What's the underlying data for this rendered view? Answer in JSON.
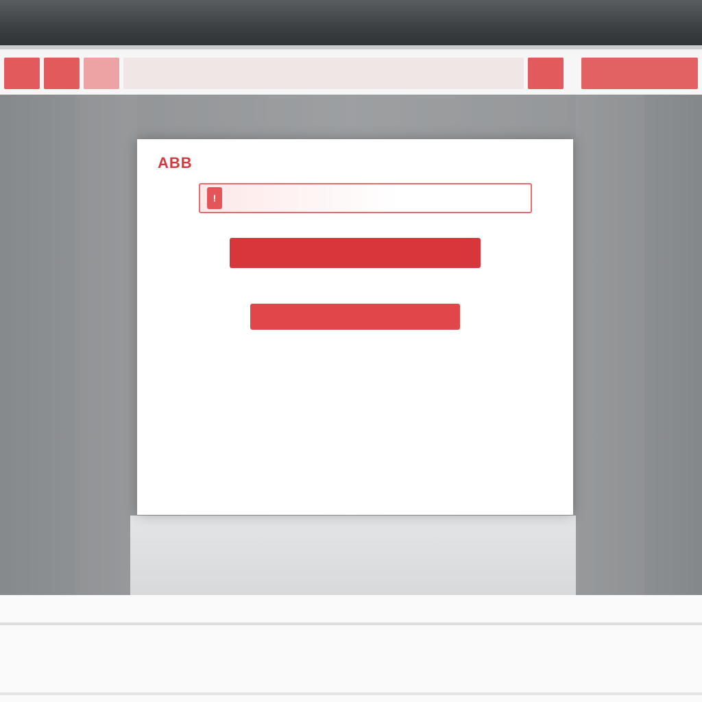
{
  "header": {
    "nav_chips": [
      "",
      "",
      "",
      ""
    ],
    "nav_right_label": ""
  },
  "modal": {
    "brand": "ABB",
    "close_label": "",
    "banner_text": "",
    "lead": "",
    "paragraph": [
      "",
      ""
    ],
    "paragraph2": [
      "",
      ""
    ],
    "primary_button": "",
    "secondary_button": "",
    "footnote": ""
  },
  "footer": {
    "links": [
      "",
      "",
      "",
      "",
      "",
      "",
      ""
    ]
  },
  "colors": {
    "accent": "#d8363a",
    "backdrop": "#a3a5a7"
  }
}
